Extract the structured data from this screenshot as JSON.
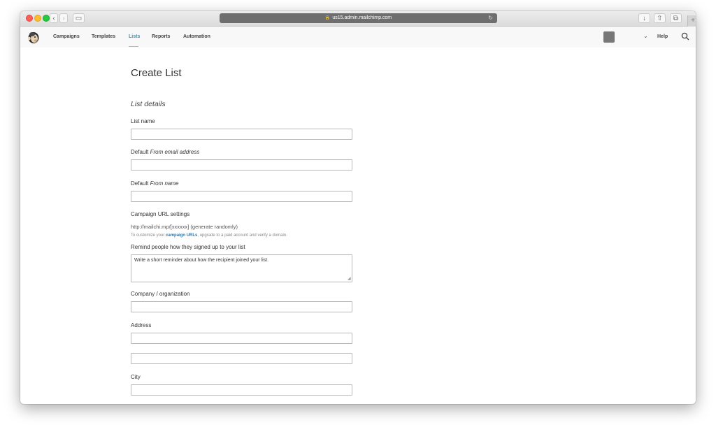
{
  "browser": {
    "url": "us15.admin.mailchimp.com"
  },
  "nav": {
    "items": [
      {
        "label": "Campaigns"
      },
      {
        "label": "Templates"
      },
      {
        "label": "Lists"
      },
      {
        "label": "Reports"
      },
      {
        "label": "Automation"
      }
    ],
    "active": "Lists",
    "help": "Help",
    "accent_color": "#3f8db8"
  },
  "page": {
    "title": "Create List",
    "section_title": "List details"
  },
  "form": {
    "list_name": {
      "label": "List name",
      "value": ""
    },
    "from_email": {
      "label_prefix": "Default ",
      "label_em": "From email address",
      "value": ""
    },
    "from_name": {
      "label_prefix": "Default ",
      "label_em": "From name",
      "value": ""
    },
    "campaign_url": {
      "label": "Campaign URL settings",
      "value": "http://mailchi.mp/[xxxxxx] (generate randomly)",
      "hint_before": "To customize your ",
      "hint_link": "campaign URLs",
      "hint_after": ", upgrade to a paid account and verify a domain."
    },
    "reminder": {
      "label": "Remind people how they signed up to your list",
      "value": "Write a short reminder about how the recipient joined your list."
    },
    "company": {
      "label": "Company / organization",
      "value": ""
    },
    "address": {
      "label": "Address",
      "line1": "",
      "line2": ""
    },
    "city": {
      "label": "City",
      "value": ""
    }
  }
}
